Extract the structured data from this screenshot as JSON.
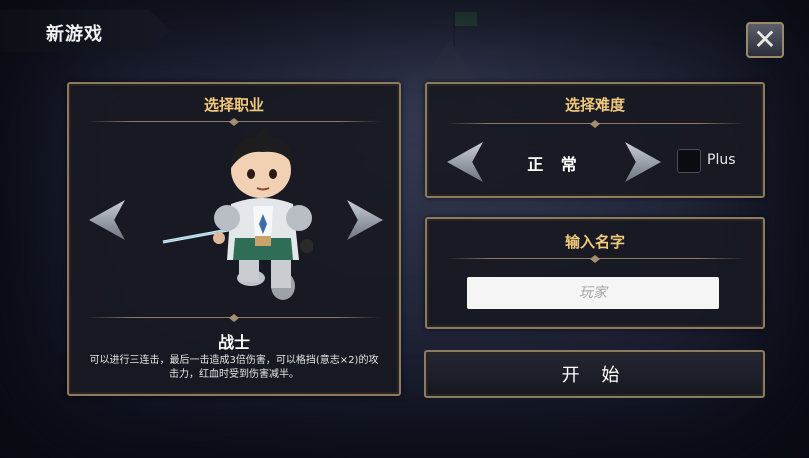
{
  "header": {
    "title": "新游戏",
    "close_icon": "close-icon"
  },
  "class_panel": {
    "title": "选择职业",
    "class_name": "战士",
    "description": "可以进行三连击，最后一击造成3倍伤害，可以格挡(意志×2)的攻击力，红血时受到伤害减半。",
    "prev_icon": "arrow-left-icon",
    "next_icon": "arrow-right-icon"
  },
  "difficulty_panel": {
    "title": "选择难度",
    "value": "正 常",
    "plus_label": "Plus",
    "plus_checked": false
  },
  "name_panel": {
    "title": "输入名字",
    "placeholder": "玩家",
    "value": ""
  },
  "start_button": {
    "label": "开 始"
  },
  "colors": {
    "gold_title": "#f0c97a",
    "frame": "#8c7a62",
    "panel_bg": "#18192288"
  }
}
